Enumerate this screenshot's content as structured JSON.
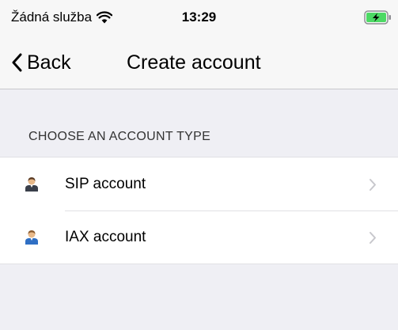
{
  "status_bar": {
    "carrier": "Žádná služba",
    "time": "13:29",
    "wifi_icon": "wifi-icon",
    "battery_icon": "battery-charging-icon"
  },
  "nav": {
    "back_label": "Back",
    "title": "Create account"
  },
  "section": {
    "header": "CHOOSE AN ACCOUNT TYPE"
  },
  "accounts": {
    "items": [
      {
        "label": "SIP account",
        "icon": "user-avatar-icon",
        "shirt_color": "#3a3f4a"
      },
      {
        "label": "IAX account",
        "icon": "user-avatar-icon",
        "shirt_color": "#2f6fc4"
      }
    ]
  },
  "colors": {
    "background": "#efeff4",
    "bar": "#f7f7f7",
    "separator": "#c8c7cc",
    "chevron": "#c7c7cc",
    "battery_green": "#4cd964"
  }
}
